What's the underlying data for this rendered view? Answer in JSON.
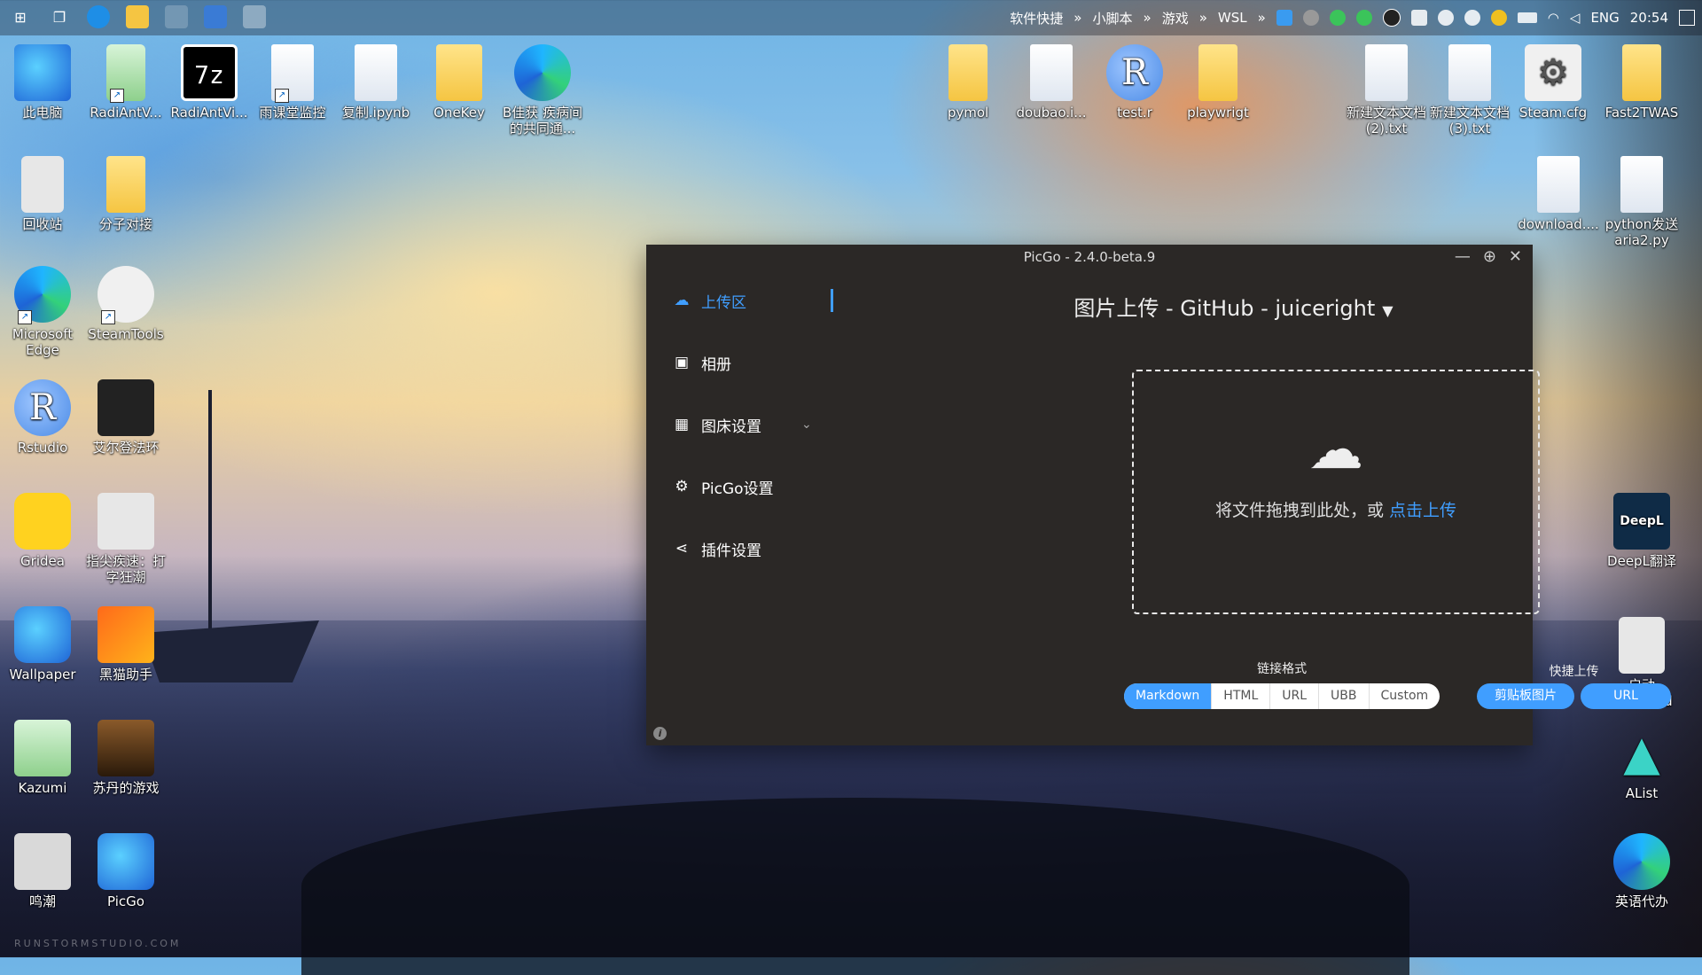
{
  "taskbar": {
    "tray_text": [
      "软件快捷",
      "小脚本",
      "游戏",
      "WSL"
    ],
    "language": "ENG",
    "time": "20:54"
  },
  "desktop_icons": [
    {
      "label": "此电脑"
    },
    {
      "label": "RadiAntV..."
    },
    {
      "label": "RadiAntVi..."
    },
    {
      "label": "雨课堂监控"
    },
    {
      "label": "复制.ipynb"
    },
    {
      "label": "OneKey"
    },
    {
      "label": "B佳获 疾病间的共同通..."
    },
    {
      "label": "回收站"
    },
    {
      "label": "分子对接"
    },
    {
      "label": "Microsoft Edge"
    },
    {
      "label": "SteamTools"
    },
    {
      "label": "Rstudio"
    },
    {
      "label": "艾尔登法环"
    },
    {
      "label": "Gridea"
    },
    {
      "label": "指尖疾速：打字狂潮"
    },
    {
      "label": "Wallpaper"
    },
    {
      "label": "黑猫助手"
    },
    {
      "label": "Kazumi"
    },
    {
      "label": "苏丹的游戏"
    },
    {
      "label": "鸣潮"
    },
    {
      "label": "PicGo"
    },
    {
      "label": "pymol"
    },
    {
      "label": "doubao.i..."
    },
    {
      "label": "test.r"
    },
    {
      "label": "playwrigt"
    },
    {
      "label": "新建文本文档 (2).txt"
    },
    {
      "label": "新建文本文档 (3).txt"
    },
    {
      "label": "Steam.cfg"
    },
    {
      "label": "Fast2TWAS"
    },
    {
      "label": "download...."
    },
    {
      "label": "python发送 aria2.py"
    },
    {
      "label": "DeepL翻译"
    },
    {
      "label": "启动 Alist.cmd"
    },
    {
      "label": "AList"
    },
    {
      "label": "英语代办"
    }
  ],
  "icon_text": {
    "r": "R",
    "seven": "7z",
    "deepl": "DeepL"
  },
  "window": {
    "title": "PicGo - 2.4.0-beta.9",
    "controls": {
      "minimize": "—",
      "pin": "⊕",
      "close": "✕"
    }
  },
  "sidebar": {
    "items": [
      {
        "label": "上传区",
        "icon": "upload-cloud-icon",
        "active": true
      },
      {
        "label": "相册",
        "icon": "image-icon"
      },
      {
        "label": "图床设置",
        "icon": "grid-icon",
        "has_submenu": true
      },
      {
        "label": "PicGo设置",
        "icon": "gear-icon"
      },
      {
        "label": "插件设置",
        "icon": "share-icon"
      }
    ]
  },
  "upload": {
    "heading": "图片上传 - GitHub - juiceright",
    "drop_text": "将文件拖拽到此处，或 ",
    "drop_link": "点击上传",
    "link_format_label": "链接格式",
    "formats": [
      "Markdown",
      "HTML",
      "URL",
      "UBB",
      "Custom"
    ],
    "selected_format": "Markdown",
    "quick_upload_label": "快捷上传",
    "quick_buttons": [
      "剪贴板图片",
      "URL"
    ]
  },
  "watermark": "RUNSTORMSTUDIO.COM",
  "colors": {
    "accent": "#409eff",
    "window_bg": "#2b2826"
  }
}
